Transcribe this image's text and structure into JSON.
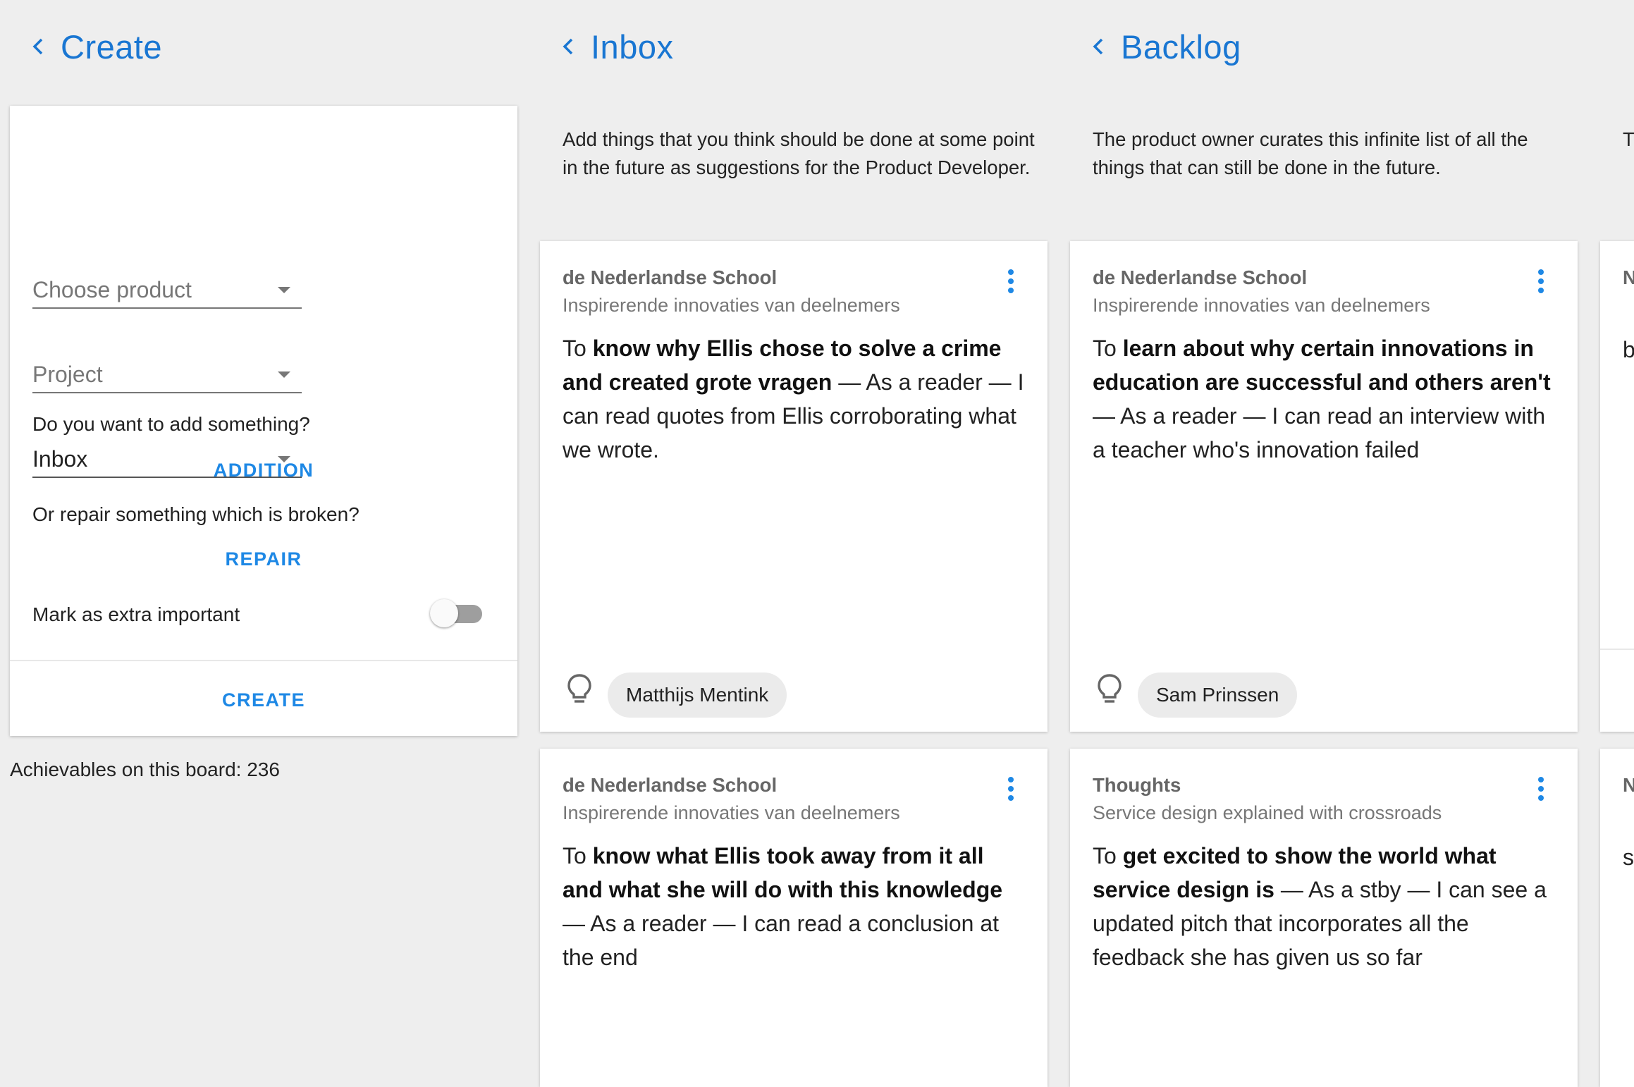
{
  "columns": [
    {
      "title": "Create"
    },
    {
      "title": "Inbox",
      "description": "Add things that you think should be done at some point in the future as suggestions for the Product Developer."
    },
    {
      "title": "Backlog",
      "description": "The product owner curates this infinite list of all the things that can still be done in the future."
    }
  ],
  "partial_column": {
    "desc_letter": "T",
    "card1_letters": [
      "N",
      "b"
    ],
    "card2_letters": [
      "N",
      "s"
    ]
  },
  "create": {
    "product_placeholder": "Choose product",
    "project_placeholder": "Project",
    "column_value": "Inbox",
    "add_question": "Do you want to add something?",
    "addition_label": "ADDITION",
    "repair_question": "Or repair something which is broken?",
    "repair_label": "REPAIR",
    "important_label": "Mark as extra important",
    "important_on": false,
    "create_label": "CREATE"
  },
  "board_count_text": "Achievables on this board: 236",
  "cards": {
    "inbox_1": {
      "org": "de Nederlandse School",
      "project": "Inspirerende innovaties van deelnemers",
      "to": "To ",
      "goal": "know why Ellis chose to solve a crime and created grote vragen",
      "role_sep": " — As a reader — ",
      "action": "I can read quotes from Ellis corroborating what we wrote.",
      "author": "Matthijs Mentink"
    },
    "backlog_1": {
      "org": "de Nederlandse School",
      "project": "Inspirerende innovaties van deelnemers",
      "to": "To ",
      "goal": "learn about why certain innovations in education are successful and others aren't",
      "role_sep": " — As a reader — ",
      "action": "I can read an interview with a teacher who's innovation failed",
      "author": "Sam Prinssen"
    },
    "inbox_2": {
      "org": "de Nederlandse School",
      "project": "Inspirerende innovaties van deelnemers",
      "to": "To ",
      "goal": "know what Ellis took away from it all and what she will do with this knowledge",
      "role_sep": " — As a reader — ",
      "action": "I can read a conclusion at the end"
    },
    "backlog_2": {
      "org": "Thoughts",
      "project": "Service design explained with crossroads",
      "to": "To ",
      "goal": "get excited to show the world what service design is",
      "role_sep": " — As a stby — ",
      "action": "I can see a updated pitch that incorporates all the feedback she has given us so far"
    }
  },
  "icons": {
    "back": "chevron-left-icon",
    "menu": "more-vert-icon",
    "idea": "lightbulb-icon"
  },
  "colors": {
    "accent": "#1e88e5",
    "title": "#1976d2",
    "background": "#eeeeee"
  }
}
